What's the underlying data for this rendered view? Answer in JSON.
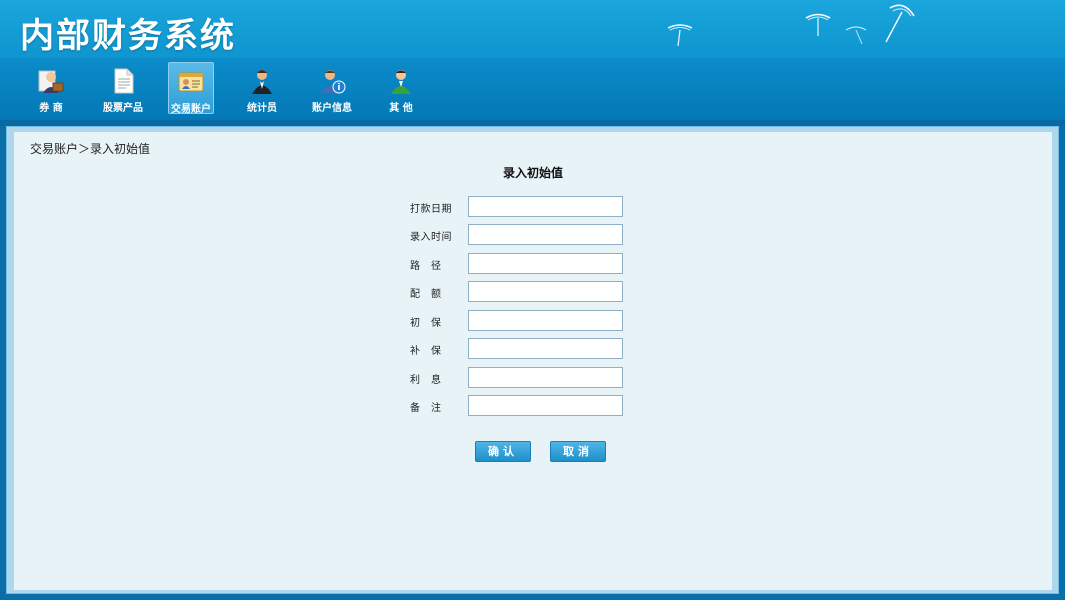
{
  "header": {
    "title": "内部财务系统"
  },
  "nav": {
    "items": [
      {
        "label": "券 商",
        "icon": "broker-person-icon"
      },
      {
        "label": "股票产品",
        "icon": "document-icon"
      },
      {
        "label": "交易账户",
        "icon": "id-card-icon",
        "active": true
      },
      {
        "label": "统计员",
        "icon": "waiter-person-icon"
      },
      {
        "label": "账户信息",
        "icon": "user-info-icon"
      },
      {
        "label": "其 他",
        "icon": "person-icon"
      }
    ]
  },
  "breadcrumb": "交易账户＞录入初始值",
  "form": {
    "title": "录入初始值",
    "fields": [
      {
        "label": "打款日期",
        "value": ""
      },
      {
        "label": "录入时间",
        "value": ""
      },
      {
        "label": "路　径",
        "value": ""
      },
      {
        "label": "配　额",
        "value": ""
      },
      {
        "label": "初　保",
        "value": ""
      },
      {
        "label": "补　保",
        "value": ""
      },
      {
        "label": "利　息",
        "value": ""
      },
      {
        "label": "备　注",
        "value": ""
      }
    ],
    "confirm_label": "确认",
    "cancel_label": "取消"
  },
  "colors": {
    "header_bg": "#1aa6dc",
    "nav_bg": "#0478b6",
    "panel_bg": "#e8f3f8",
    "button_bg": "#2d9fd8"
  }
}
